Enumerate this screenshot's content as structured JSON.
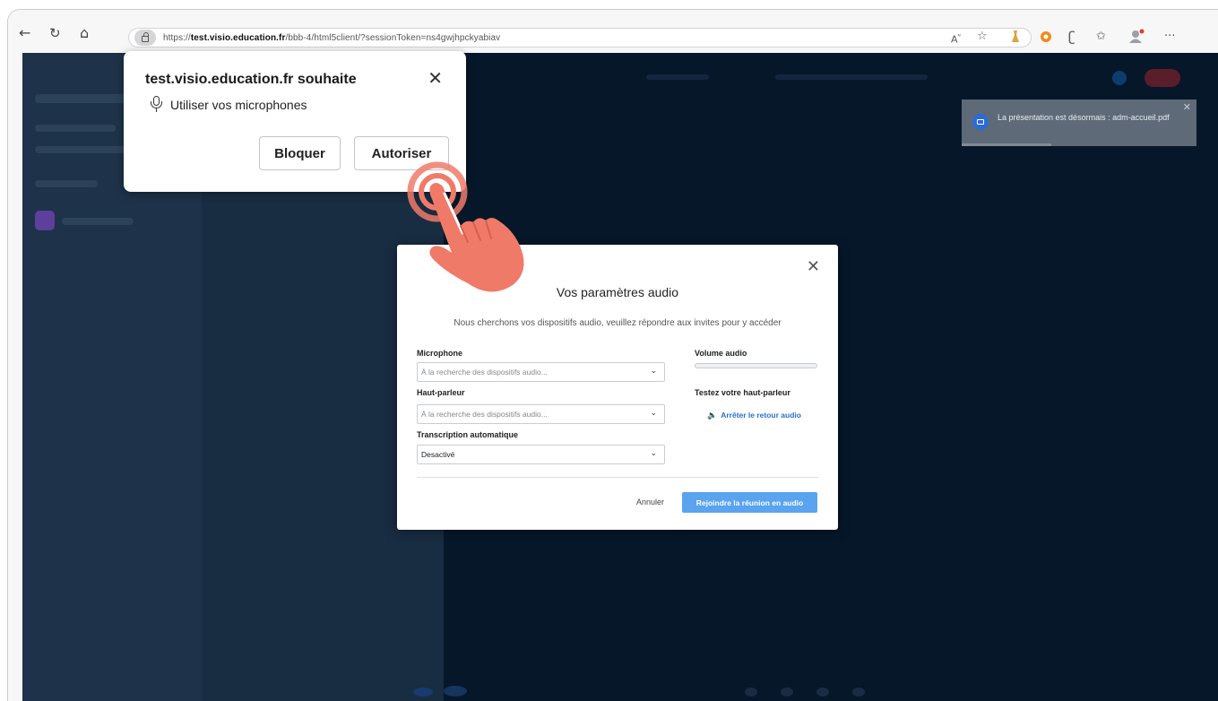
{
  "browser": {
    "url_prefix": "https://",
    "url_host": "test.visio.education.fr",
    "url_path": "/bbb-4/html5client/?sessionToken=ns4gwjhpckyabiav",
    "icons": [
      "back-icon",
      "refresh-icon",
      "home-icon",
      "lock-icon",
      "read-aloud-icon",
      "favorite-star-icon",
      "extension-icon",
      "extension-icon",
      "copilot-icon",
      "favorites-icon",
      "profile-icon",
      "more-icon"
    ]
  },
  "permission_prompt": {
    "title": "test.visio.education.fr souhaite",
    "request": "Utiliser vos microphones",
    "block_label": "Bloquer",
    "allow_label": "Autoriser",
    "close_glyph": "✕"
  },
  "toast": {
    "message": "La présentation est désormais : adm-accueil.pdf",
    "close_glyph": "✕"
  },
  "audio_modal": {
    "title": "Vos paramètres audio",
    "subtitle": "Nous cherchons vos dispositifs audio, veuillez répondre aux invites pour y accéder",
    "close_glyph": "✕",
    "microphone": {
      "label": "Microphone",
      "value": "À la recherche des dispositifs audio..."
    },
    "speaker": {
      "label": "Haut-parleur",
      "value": "À la recherche des dispositifs audio..."
    },
    "transcription": {
      "label": "Transcription automatique",
      "value": "Desactivé"
    },
    "volume_label": "Volume audio",
    "volume_level": 0,
    "test_label": "Testez votre haut-parleur",
    "stop_echo_label": "Arrêter le retour audio",
    "cancel_label": "Annuler",
    "join_label": "Rejoindre la réunion en audio"
  },
  "colors": {
    "page_bg": "#06172a",
    "join_button": "#5aa3ef",
    "link": "#2a6fd1",
    "hand_highlight": "#f07a68"
  }
}
